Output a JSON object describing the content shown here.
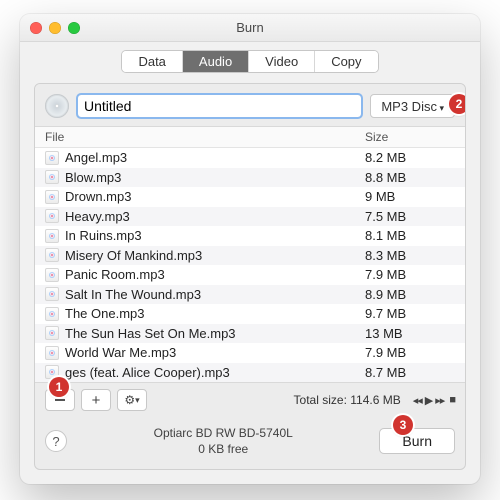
{
  "window": {
    "title": "Burn"
  },
  "tabs": {
    "data": "Data",
    "audio": "Audio",
    "video": "Video",
    "copy": "Copy",
    "active": "audio"
  },
  "disc": {
    "title_value": "Untitled",
    "type_button": "MP3 Disc"
  },
  "columns": {
    "file": "File",
    "size": "Size"
  },
  "files": [
    {
      "name": "Angel.mp3",
      "size": "8.2 MB"
    },
    {
      "name": "Blow.mp3",
      "size": "8.8 MB"
    },
    {
      "name": "Drown.mp3",
      "size": "9 MB"
    },
    {
      "name": "Heavy.mp3",
      "size": "7.5 MB"
    },
    {
      "name": "In Ruins.mp3",
      "size": "8.1 MB"
    },
    {
      "name": "Misery Of Mankind.mp3",
      "size": "8.3 MB"
    },
    {
      "name": "Panic Room.mp3",
      "size": "7.9 MB"
    },
    {
      "name": "Salt In The Wound.mp3",
      "size": "8.9 MB"
    },
    {
      "name": "The One.mp3",
      "size": "9.7 MB"
    },
    {
      "name": "The Sun Has Set On Me.mp3",
      "size": "13 MB"
    },
    {
      "name": "World War Me.mp3",
      "size": "7.9 MB"
    },
    {
      "name": "ges (feat. Alice Cooper).mp3",
      "size": "8.7 MB"
    }
  ],
  "toolbar": {
    "remove_label": "−",
    "add_label": "+",
    "total_label": "Total size:",
    "total_value": "114.6 MB"
  },
  "footer": {
    "help": "?",
    "drive_name": "Optiarc BD RW BD-5740L",
    "free": "0 KB free",
    "burn": "Burn"
  },
  "callouts": {
    "c1": "1",
    "c2": "2",
    "c3": "3"
  }
}
